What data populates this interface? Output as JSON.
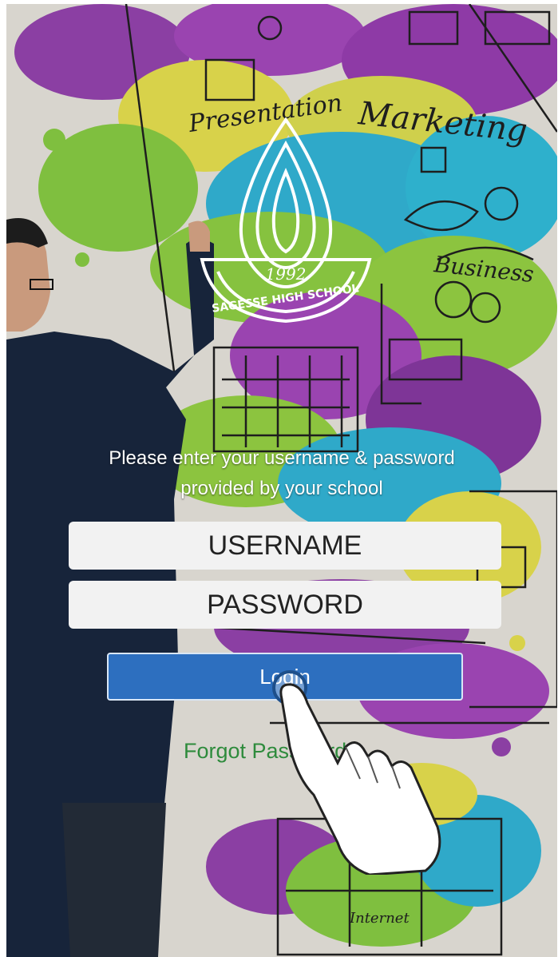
{
  "logo": {
    "name": "SAGESSE HIGH SCHOOL",
    "year": "1992"
  },
  "background_words": {
    "presentation": "Presentation",
    "marketing": "Marketing",
    "business": "Business",
    "internet": "Internet"
  },
  "login_form": {
    "prompt_line1": "Please enter your username & password",
    "prompt_line2": "provided by your school",
    "username_placeholder": "USERNAME",
    "password_placeholder": "PASSWORD",
    "login_label": "Login",
    "forgot_label": "Forgot Password?"
  },
  "colors": {
    "login_button": "#2d6fbf",
    "forgot_link": "#2e8b3c",
    "input_background": "#f2f2f2"
  },
  "icons": [
    "school-logo-icon",
    "pointing-hand-icon"
  ]
}
